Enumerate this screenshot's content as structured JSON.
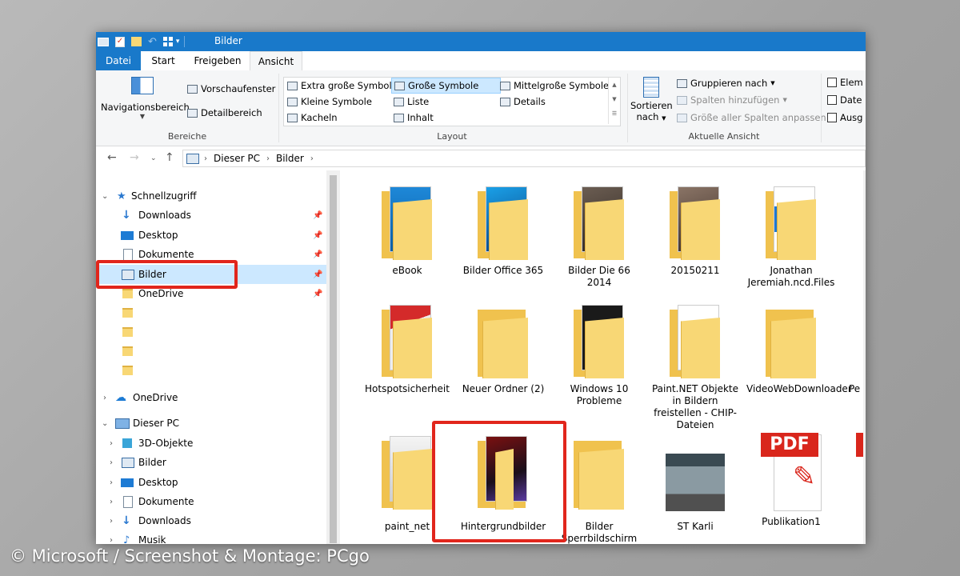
{
  "titlebar": {
    "title": "Bilder"
  },
  "ribbon_tabs": [
    "Datei",
    "Start",
    "Freigeben",
    "Ansicht"
  ],
  "ribbon": {
    "bereiche": {
      "nav": "Navigationsbereich",
      "preview": "Vorschaufenster",
      "detail": "Detailbereich",
      "label": "Bereiche"
    },
    "layout": {
      "items": [
        "Extra große Symbole",
        "Große Symbole",
        "Mittelgroße Symbole",
        "Kleine Symbole",
        "Liste",
        "Details",
        "Kacheln",
        "Inhalt"
      ],
      "selected": "Große Symbole",
      "label": "Layout"
    },
    "aktuelle": {
      "sort_line1": "Sortieren",
      "sort_line2": "nach",
      "group": "Gruppieren nach",
      "add_cols": "Spalten hinzufügen",
      "fit_cols": "Größe aller Spalten anpassen",
      "label": "Aktuelle Ansicht"
    },
    "checks": [
      "Elem",
      "Date",
      "Ausg"
    ]
  },
  "address": {
    "crumbs": [
      "Dieser PC",
      "Bilder"
    ]
  },
  "sidebar": {
    "quick_access": "Schnellzugriff",
    "quick_items": [
      "Downloads",
      "Desktop",
      "Dokumente",
      "Bilder",
      "OneDrive"
    ],
    "onedrive": "OneDrive",
    "this_pc": "Dieser PC",
    "pc_items": [
      "3D-Objekte",
      "Bilder",
      "Desktop",
      "Dokumente",
      "Downloads",
      "Musik"
    ]
  },
  "content": {
    "row1": [
      "eBook",
      "Bilder Office 365",
      "Bilder Die 66 2014",
      "20150211",
      "Jonathan Jeremiah.ncd.Files"
    ],
    "row2": [
      "Hotspotsicherheit",
      "Neuer Ordner (2)",
      "Windows 10 Probleme",
      "Paint.NET  Objekte in Bildern freistellen - CHIP-Dateien",
      "VideoWebDownloader",
      "Pe"
    ],
    "row3": [
      "paint_net",
      "Hintergrundbilder",
      "Bilder Sperrbildschirm",
      "ST Karli",
      "Publikation1"
    ],
    "pdf_badge": "PDF"
  },
  "watermark": "© Microsoft / Screenshot & Montage: PCgo",
  "colors": {
    "accent": "#1979ca",
    "highlight": "#e1261c",
    "folder": "#f8d775"
  }
}
